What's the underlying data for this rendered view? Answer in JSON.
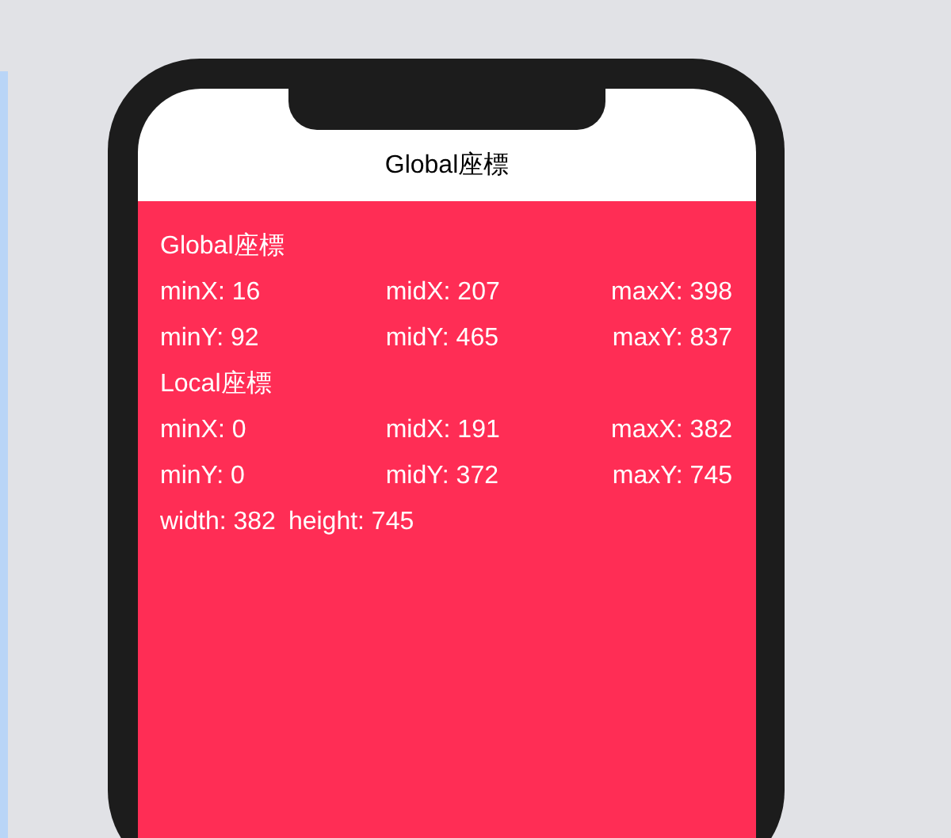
{
  "nav_title": "Global座標",
  "sections": [
    {
      "title": "Global座標",
      "rows": [
        [
          "minX: 16",
          "midX: 207",
          "maxX: 398"
        ],
        [
          "minY: 92",
          "midY: 465",
          "maxY: 837"
        ]
      ]
    },
    {
      "title": "Local座標",
      "rows": [
        [
          "minX: 0",
          "midX: 191",
          "maxX: 382"
        ],
        [
          "minY: 0",
          "midY: 372",
          "maxY: 745"
        ]
      ]
    }
  ],
  "size_labels": [
    "width: 382",
    "height: 745"
  ]
}
